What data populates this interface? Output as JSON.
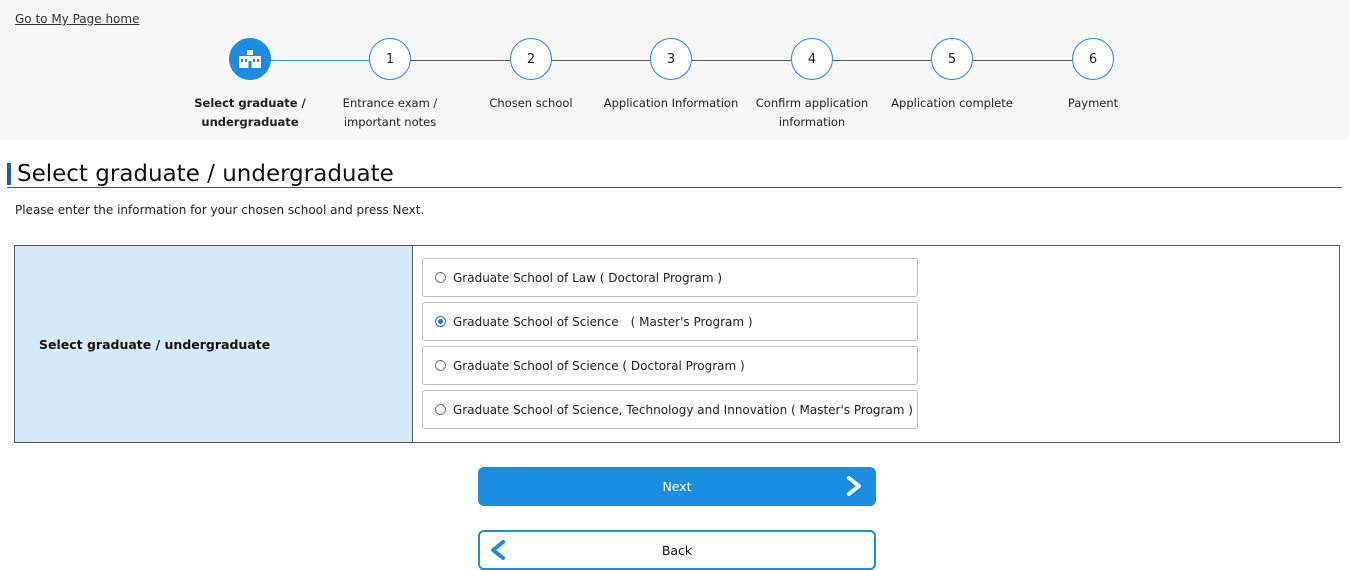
{
  "nav": {
    "home_link": "Go to My Page home"
  },
  "stepper": {
    "steps": [
      {
        "number": "",
        "label_line1": "Select graduate /",
        "label_line2": "undergraduate",
        "icon": "school-icon"
      },
      {
        "number": "1",
        "label_line1": "Entrance exam /",
        "label_line2": "important notes"
      },
      {
        "number": "2",
        "label_line1": "Chosen school",
        "label_line2": ""
      },
      {
        "number": "3",
        "label_line1": "Application Information",
        "label_line2": ""
      },
      {
        "number": "4",
        "label_line1": "Confirm application",
        "label_line2": "information"
      },
      {
        "number": "5",
        "label_line1": "Application complete",
        "label_line2": ""
      },
      {
        "number": "6",
        "label_line1": "Payment",
        "label_line2": ""
      }
    ]
  },
  "main": {
    "title": "Select graduate / undergraduate",
    "instruction": "Please enter the information for your chosen school and press Next.",
    "form": {
      "label": "Select graduate / undergraduate",
      "options": [
        {
          "label": "Graduate School of Law ( Doctoral Program )",
          "selected": false
        },
        {
          "label": "Graduate School of Science　( Master's Program )",
          "selected": true
        },
        {
          "label": "Graduate School of Science ( Doctoral Program )",
          "selected": false
        },
        {
          "label": "Graduate School of Science, Technology and Innovation ( Master's Program )",
          "selected": false
        }
      ]
    },
    "next_label": "Next",
    "back_label": "Back"
  },
  "colors": {
    "accent": "#1a8de0",
    "label_bg": "#d6e9f8",
    "title_bar": "#1b5fa8"
  }
}
